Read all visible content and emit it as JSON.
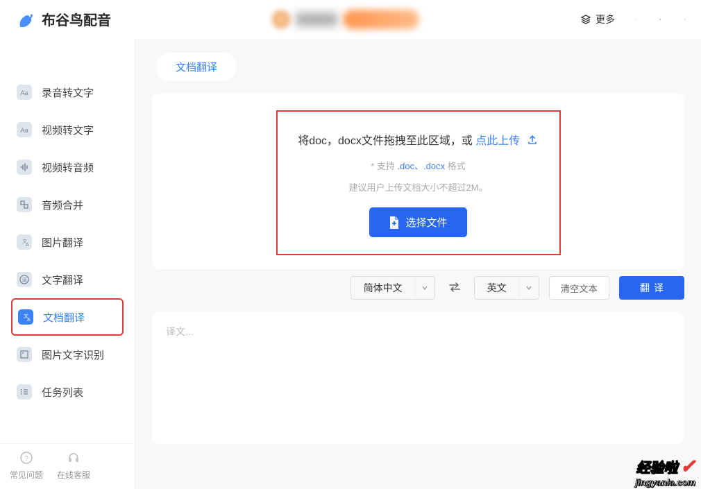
{
  "titlebar": {
    "app_name": "布谷鸟配音",
    "more_label": "更多"
  },
  "sidebar": {
    "items": [
      {
        "label": "录音转文字"
      },
      {
        "label": "视频转文字"
      },
      {
        "label": "视频转音频"
      },
      {
        "label": "音频合并"
      },
      {
        "label": "图片翻译"
      },
      {
        "label": "文字翻译"
      },
      {
        "label": "文档翻译"
      },
      {
        "label": "图片文字识别"
      },
      {
        "label": "任务列表"
      }
    ],
    "footer": {
      "faq": "常见问题",
      "support": "在线客服"
    }
  },
  "content": {
    "tab_label": "文档翻译",
    "upload": {
      "text_prefix": "将doc，docx文件拖拽至此区域，或 ",
      "link_text": "点此上传",
      "support_prefix": "* 支持 ",
      "support_formats": ".doc、.docx",
      "support_suffix": " 格式",
      "size_hint": "建议用户上传文档大小不超过2M。",
      "select_btn": "选择文件"
    },
    "controls": {
      "source_lang": "简体中文",
      "target_lang": "英文",
      "clear_label": "清空文本",
      "translate_label": "翻译"
    },
    "output_placeholder": "译文..."
  },
  "watermark": {
    "line1": "经验啦",
    "line2": "jingyanla.com"
  }
}
